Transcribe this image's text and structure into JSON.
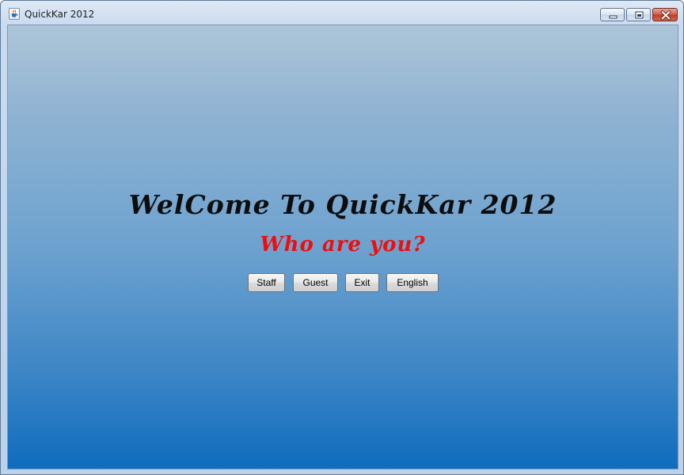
{
  "window": {
    "title": "QuickKar 2012",
    "app_icon": "java-cup-icon",
    "controls": {
      "minimize_icon": "minimize-icon",
      "maximize_icon": "maximize-icon",
      "close_icon": "close-icon"
    }
  },
  "main": {
    "welcome_text": "WelCome To QuickKar 2012",
    "question_text": "Who are you?",
    "buttons": {
      "staff": "Staff",
      "guest": "Guest",
      "exit": "Exit",
      "english": "English"
    }
  },
  "colors": {
    "welcome_text": "#0d0d0d",
    "question_text": "#f20c0c",
    "background_top": "#aec5d8",
    "background_bottom": "#0f6cbd",
    "close_button": "#c13a22"
  }
}
